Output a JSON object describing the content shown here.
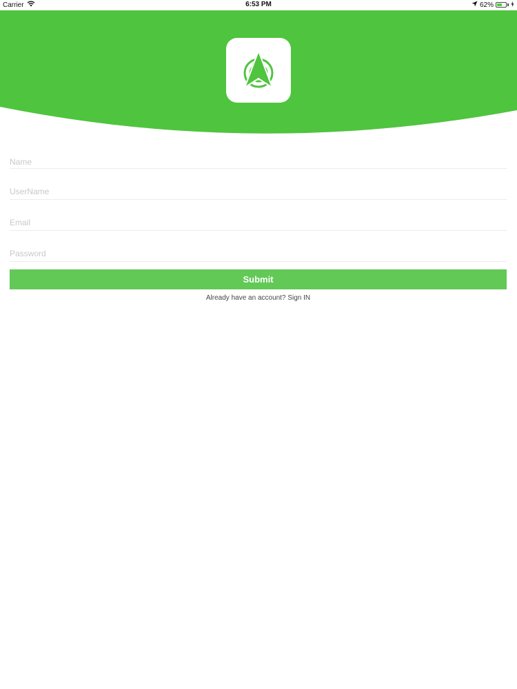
{
  "status_bar": {
    "carrier": "Carrier",
    "time": "6:53 PM",
    "battery_percent": "62%",
    "battery_level": 0.62
  },
  "header": {
    "background_color": "#4fc43e",
    "logo_icon": "navigation-arrow-icon"
  },
  "form": {
    "name_placeholder": "Name",
    "username_placeholder": "UserName",
    "email_placeholder": "Email",
    "password_placeholder": "Password",
    "submit_label": "Submit",
    "account_prompt": "Already have an account? ",
    "signin_label": "Sign IN"
  },
  "colors": {
    "accent": "#4fc43e",
    "button": "#62c957"
  }
}
